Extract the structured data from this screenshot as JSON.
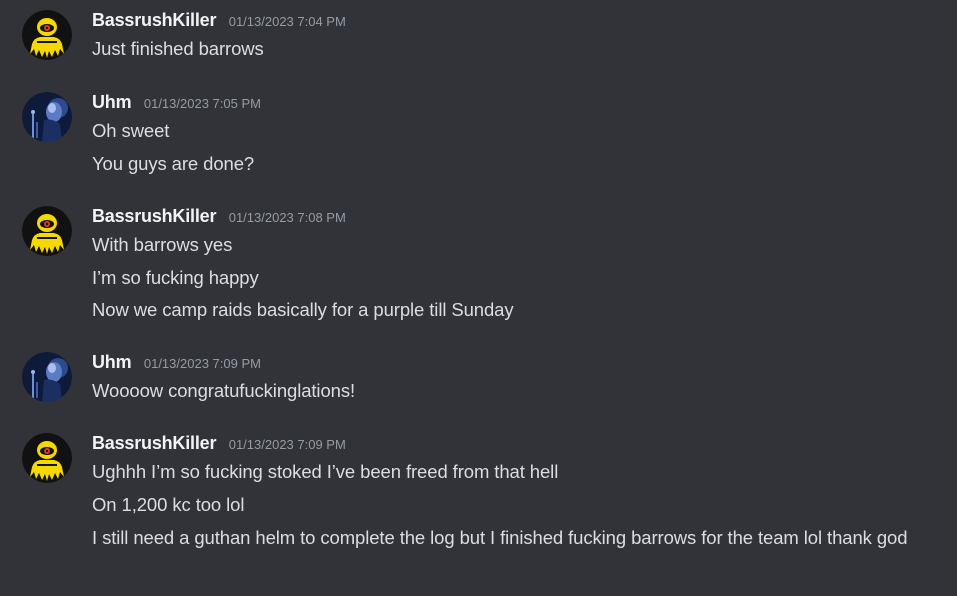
{
  "colors": {
    "background": "#313338",
    "username": "#f2f3f5",
    "timestamp": "#949ba4",
    "message_text": "#dbdee1"
  },
  "messages": [
    {
      "author": "BassrushKiller",
      "timestamp": "01/13/2023 7:04 PM",
      "avatar_icon": "yellow-character-avatar-icon",
      "lines": [
        "Just finished barrows"
      ]
    },
    {
      "author": "Uhm",
      "timestamp": "01/13/2023 7:05 PM",
      "avatar_icon": "dark-blue-photo-avatar-icon",
      "lines": [
        "Oh sweet",
        "You guys are done?"
      ]
    },
    {
      "author": "BassrushKiller",
      "timestamp": "01/13/2023 7:08 PM",
      "avatar_icon": "yellow-character-avatar-icon",
      "lines": [
        "With barrows yes",
        "I’m so fucking happy",
        "Now we camp raids basically for a purple till Sunday"
      ]
    },
    {
      "author": "Uhm",
      "timestamp": "01/13/2023 7:09 PM",
      "avatar_icon": "dark-blue-photo-avatar-icon",
      "lines": [
        "Woooow congratufuckinglations!"
      ]
    },
    {
      "author": "BassrushKiller",
      "timestamp": "01/13/2023 7:09 PM",
      "avatar_icon": "yellow-character-avatar-icon",
      "lines": [
        "Ughhh I’m so fucking stoked I’ve been freed from that hell",
        "On 1,200 kc too lol",
        "I still need a guthan helm to complete the log but I finished fucking barrows for the team lol thank god"
      ]
    }
  ]
}
